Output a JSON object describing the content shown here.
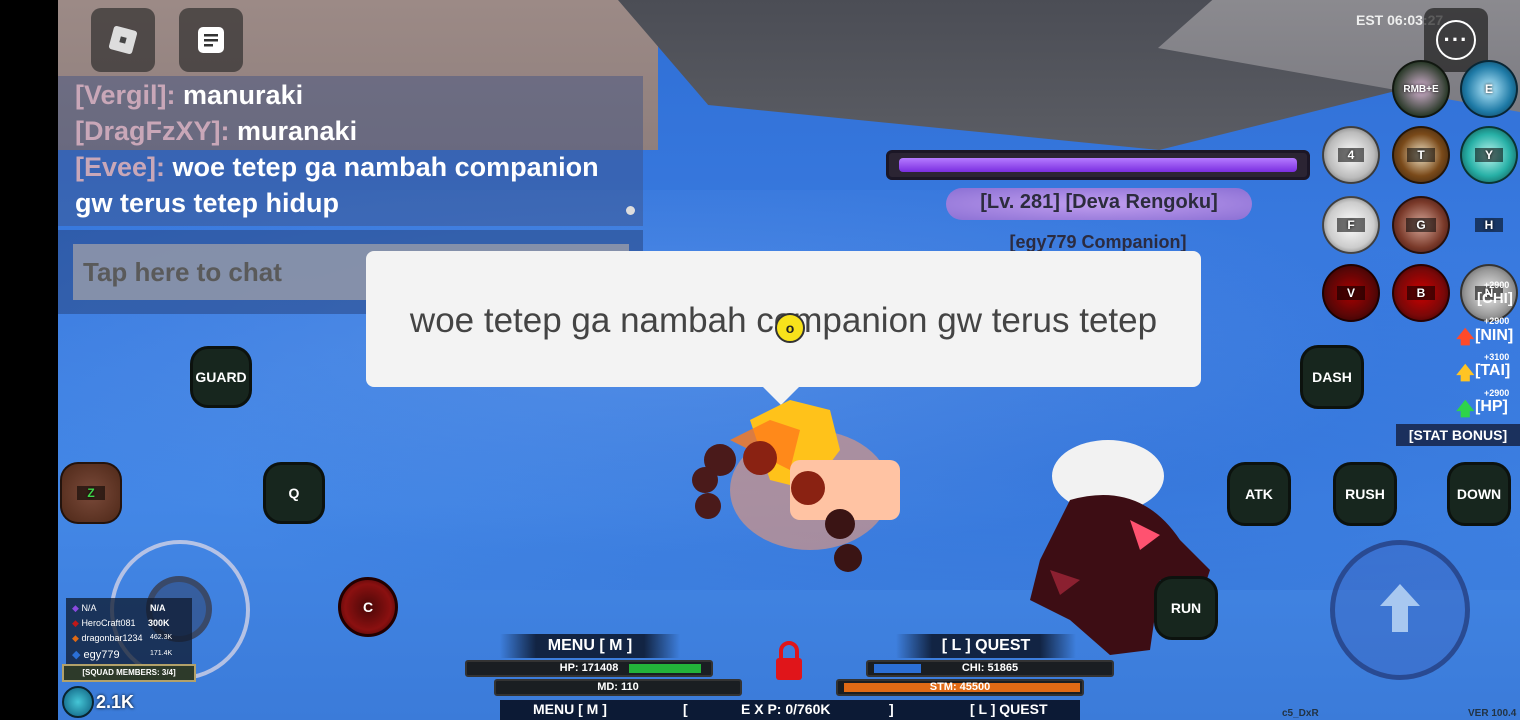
{
  "clock": "EST 06:03:27",
  "chat": {
    "messages": [
      {
        "name": "[Vergil]:",
        "text": "manuraki"
      },
      {
        "name": "[DragFzXY]:",
        "text": "muranaki"
      },
      {
        "name": "[Evee]:",
        "text": "woe tetep ga nambah companion"
      },
      {
        "name": "",
        "text": "gw terus tetep hidup"
      }
    ],
    "input_placeholder": "Tap here to chat"
  },
  "enemy": {
    "name": "[Lv. 281] [Deva Rengoku]",
    "companion": "[egy779 Companion]",
    "health_fraction": 1.0
  },
  "speech_bubble": "woe tetep ga nambah companion gw terus tetep",
  "cursor_label": "o",
  "controls": {
    "guard": "GUARD",
    "dash": "DASH",
    "q": "Q",
    "z": "Z",
    "c": "C",
    "atk": "ATK",
    "rush": "RUSH",
    "down": "DOWN",
    "run": "RUN"
  },
  "skills": {
    "rmb_e": "RMB+E",
    "e": "E",
    "four": "4",
    "t": "T",
    "y": "Y",
    "f": "F",
    "g": "G",
    "h": "H",
    "v": "V",
    "b": "B",
    "n": "N"
  },
  "bonuses": [
    {
      "amount": "+2900",
      "label": "[CHI]",
      "color": "#39b3e8",
      "arrow": ""
    },
    {
      "amount": "+2900",
      "label": "[NIN]",
      "color": "#ff4a2a",
      "arrow": "up"
    },
    {
      "amount": "+3100",
      "label": "[TAI]",
      "color": "#ffc424",
      "arrow": "up"
    },
    {
      "amount": "+2900",
      "label": "[HP]",
      "color": "#2ed44a",
      "arrow": "up"
    }
  ],
  "stat_bonus_label": "[STAT BONUS]",
  "leaderboard": {
    "rows": [
      {
        "name": "N/A",
        "value": "N/A"
      },
      {
        "name": "HeroCraft081",
        "value": "300K"
      },
      {
        "name": "dragonbar1234",
        "value": "462.3K"
      },
      {
        "name": "egy779",
        "value": "171.4K"
      }
    ],
    "squad": "[SQUAD MEMBERS: 3/4]",
    "currency": "2.1K"
  },
  "hud": {
    "menu": "MENU [ M ]",
    "quest": "[ L ] QUEST",
    "hp": "HP: 171408",
    "hp_fraction": 0.9,
    "md": "MD: 110",
    "chi": "CHI: 51865",
    "chi_fraction": 0.2,
    "stm": "STM: 45500",
    "stm_fraction": 1.0,
    "bottom_menu": "MENU [ M ]",
    "exp_open": "[",
    "exp": "E X P: 0/760K",
    "exp_close": "]",
    "bottom_quest": "[ L ] QUEST"
  },
  "footer": {
    "tag": "c5_DxR",
    "version": "VER 100.4"
  },
  "colors": {
    "hp_fill": "#23b33a",
    "chi_fill": "#2b6fd6",
    "stm_fill": "#e06a15",
    "enemy_bar": "#8a3cf0"
  }
}
